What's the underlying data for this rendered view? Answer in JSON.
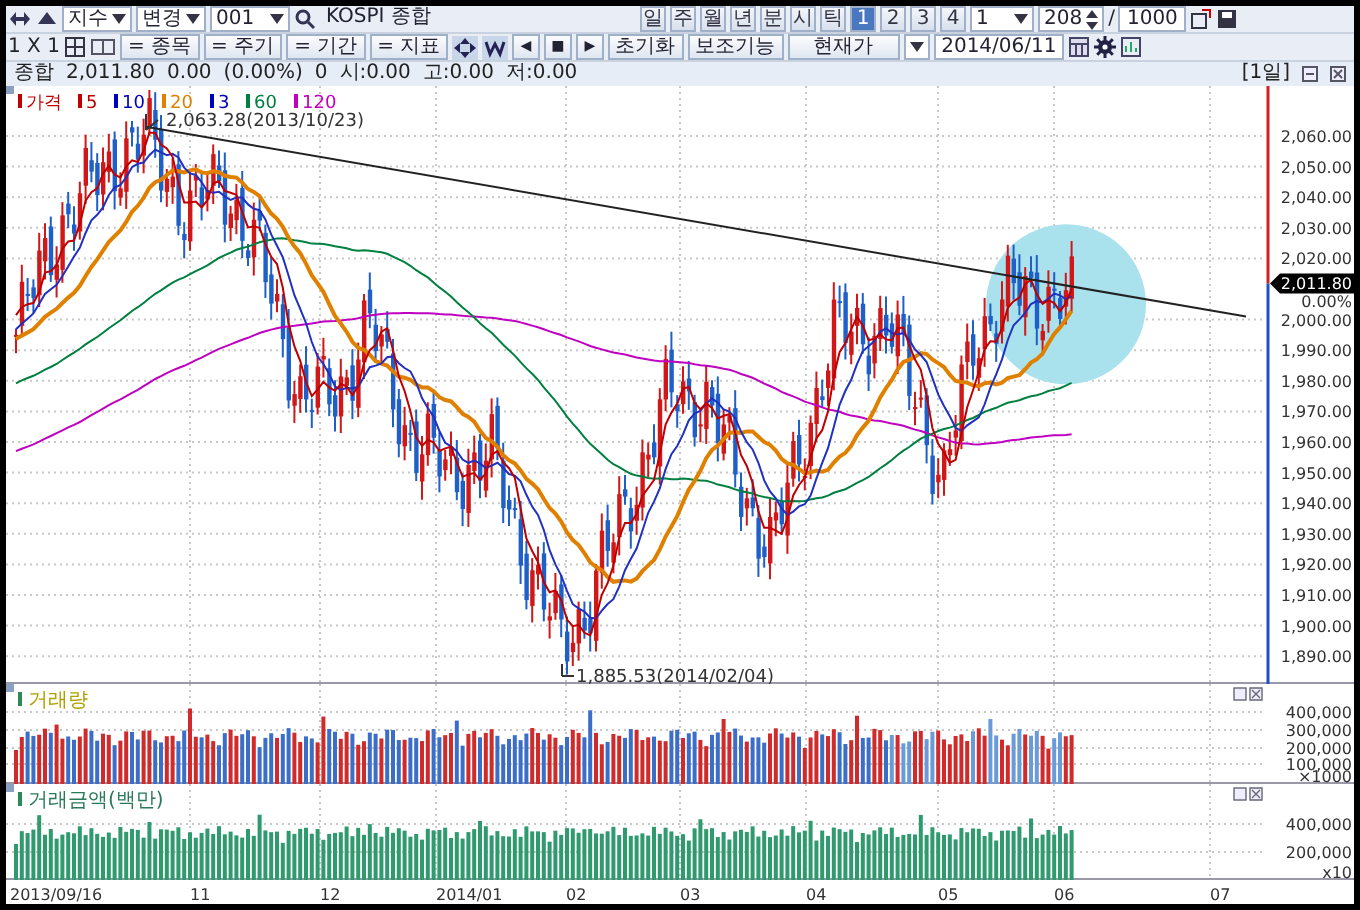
{
  "toolbar": {
    "index_combo": "지수",
    "change_combo": "변경",
    "code_combo": "001",
    "name_field": "KOSPI 종합",
    "periods": [
      {
        "label": "일",
        "selected": false
      },
      {
        "label": "주",
        "selected": false
      },
      {
        "label": "월",
        "selected": false
      },
      {
        "label": "년",
        "selected": false
      },
      {
        "label": "분",
        "selected": false
      },
      {
        "label": "시",
        "selected": false
      },
      {
        "label": "틱",
        "selected": false
      },
      {
        "label": "1",
        "selected": true
      },
      {
        "label": "2",
        "selected": false
      },
      {
        "label": "3",
        "selected": false
      },
      {
        "label": "4",
        "selected": false
      }
    ],
    "unit_combo": "1",
    "count_field": "208",
    "separator": "/",
    "max_field": "1000"
  },
  "toolbar2": {
    "layout_label": "1 X 1",
    "filters": [
      "= 종목",
      "= 주기",
      "= 기간",
      "= 지표"
    ],
    "nav_buttons": [
      "◀",
      "■",
      "▶"
    ],
    "buttons": [
      "초기화",
      "보조기능",
      "현재가"
    ],
    "date_field": "2014/06/11"
  },
  "info": {
    "name": "종합",
    "price": "2,011.80",
    "change": "0.00",
    "change_pct": "(0.00%)",
    "volume": "0",
    "open": "시:0.00",
    "high": "고:0.00",
    "low": "저:0.00",
    "period": "[1일]"
  },
  "price_panel": {
    "legend": [
      {
        "label": "가격",
        "color": "#c00000"
      },
      {
        "label": "5",
        "color": "#c00000"
      },
      {
        "label": "10",
        "color": "#0000c0"
      },
      {
        "label": "20",
        "color": "#e08000"
      },
      {
        "label": "3",
        "color": "#0000c0"
      },
      {
        "label": "60",
        "color": "#008040"
      },
      {
        "label": "120",
        "color": "#c000c0"
      }
    ],
    "high_note": "2,063.28(2013/10/23)",
    "low_note": "1,885.53(2014/02/04)",
    "y_ticks": [
      "2,060.00",
      "2,050.00",
      "2,040.00",
      "2,030.00",
      "2,020.00",
      "2,000.00",
      "1,990.00",
      "1,980.00",
      "1,970.00",
      "1,960.00",
      "1,950.00",
      "1,940.00",
      "1,930.00",
      "1,920.00",
      "1,910.00",
      "1,900.00",
      "1,890.00"
    ],
    "price_tag": "2,011.80",
    "change_tag": "0.00%"
  },
  "volume_panel": {
    "title": "거래량",
    "y_ticks": [
      "400,000",
      "300,000",
      "200,000",
      "100,000"
    ],
    "unit": "×1000"
  },
  "amount_panel": {
    "title": "거래금액(백만)",
    "y_ticks": [
      "400,000",
      "200,000"
    ],
    "unit": "x10"
  },
  "x_axis": [
    "2013/09/16",
    "11",
    "12",
    "2014/01",
    "02",
    "03",
    "04",
    "05",
    "06",
    "07"
  ]
}
